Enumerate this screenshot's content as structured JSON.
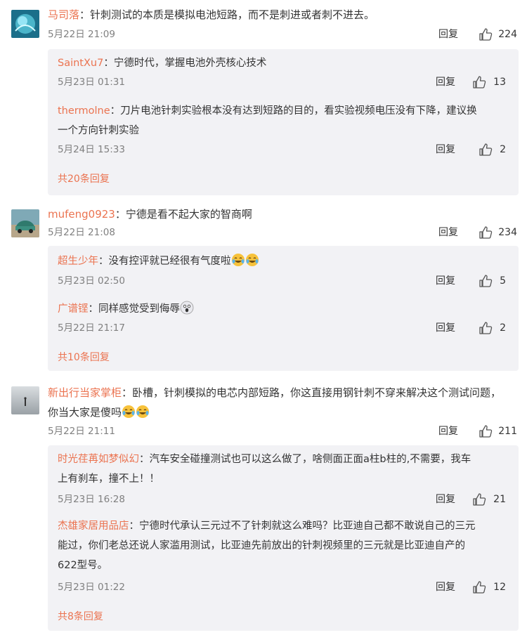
{
  "threads": [
    {
      "user": "马司落",
      "text": "针刺测试的本质是模拟电池短路，而不是刺进或者刺不进去。",
      "time": "5月22日 21:09",
      "reply_label": "回复",
      "likes": "224",
      "replies": [
        {
          "user": "SaintXu7",
          "text": "宁德时代，掌握电池外壳核心技术",
          "time": "5月23日 01:31",
          "reply_label": "回复",
          "likes": "13"
        },
        {
          "user": "thermolne",
          "text_line1": "刀片电池针刺实验根本没有达到短路的目的，看实验视频电压没有下降，建议换",
          "text_line2": "一个方向针刺实验",
          "time": "5月24日 15:33",
          "reply_label": "回复",
          "likes": "2"
        }
      ],
      "more": "共20条回复"
    },
    {
      "user": "mufeng0923",
      "text": "宁德是看不起大家的智商啊",
      "time": "5月22日 21:08",
      "reply_label": "回复",
      "likes": "234",
      "replies": [
        {
          "user": "超生少年",
          "text": "没有控评就已经很有气度啦",
          "emoji": [
            "laugh-cry",
            "laugh-cry"
          ],
          "time": "5月23日 02:50",
          "reply_label": "回复",
          "likes": "5"
        },
        {
          "user": "广谱铿",
          "text": "同样感觉受到侮辱",
          "emoji": [
            "shocked"
          ],
          "time": "5月22日 21:17",
          "reply_label": "回复",
          "likes": "2"
        }
      ],
      "more": "共10条回复"
    },
    {
      "user": "新出行当家掌柜",
      "text_line1": "卧槽，针刺模拟的电芯内部短路，你这直接用钢针刺不穿来解决这个测试问题，",
      "text_line2": "你当大家是傻吗",
      "emoji": [
        "laugh-cry",
        "laugh-cry"
      ],
      "time": "5月22日 21:11",
      "reply_label": "回复",
      "likes": "211",
      "replies": [
        {
          "user": "时光荏苒如梦似幻",
          "text_line1": "汽车安全碰撞测试也可以这么做了，啥侧面正面a柱b柱的,不需要，我车",
          "text_line2": "上有刹车，撞不上！！",
          "time": "5月23日 16:28",
          "reply_label": "回复",
          "likes": "21"
        },
        {
          "user": "杰雄家居用品店",
          "text_line1": "宁德时代承认三元过不了针刺就这么难吗？比亚迪自己都不敢说自己的三元",
          "text_line2": "能过，你们老总还说人家滥用测试，比亚迪先前放出的针刺视频里的三元就是比亚迪自产的",
          "text_line3": "622型号。",
          "time": "5月23日 01:22",
          "reply_label": "回复",
          "likes": "12"
        }
      ],
      "more": "共8条回复"
    }
  ],
  "colors": {
    "username": "#eb7350",
    "reply_bg": "#f2f2f5",
    "meta": "#808080"
  }
}
